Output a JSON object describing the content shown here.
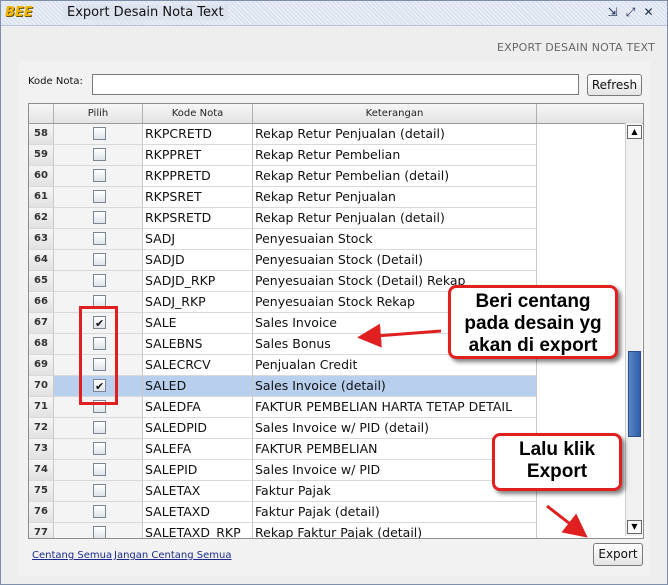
{
  "window": {
    "logo": "BEE",
    "title": "Export Desain Nota Text",
    "heading": "EXPORT DESAIN NOTA TEXT"
  },
  "filter": {
    "kode_label": "Kode Nota:",
    "kode_value": "",
    "refresh_label": "Refresh"
  },
  "table": {
    "columns": [
      "Pilih",
      "Kode Nota",
      "Keterangan"
    ],
    "rows": [
      {
        "no": "58",
        "checked": false,
        "kode": "RKPCRETD",
        "ket": "Rekap Retur Penjualan (detail)"
      },
      {
        "no": "59",
        "checked": false,
        "kode": "RKPPRET",
        "ket": "Rekap Retur Pembelian"
      },
      {
        "no": "60",
        "checked": false,
        "kode": "RKPPRETD",
        "ket": "Rekap Retur Pembelian (detail)"
      },
      {
        "no": "61",
        "checked": false,
        "kode": "RKPSRET",
        "ket": "Rekap Retur Penjualan"
      },
      {
        "no": "62",
        "checked": false,
        "kode": "RKPSRETD",
        "ket": "Rekap Retur Penjualan (detail)"
      },
      {
        "no": "63",
        "checked": false,
        "kode": "SADJ",
        "ket": "Penyesuaian Stock"
      },
      {
        "no": "64",
        "checked": false,
        "kode": "SADJD",
        "ket": "Penyesuaian Stock (Detail)"
      },
      {
        "no": "65",
        "checked": false,
        "kode": "SADJD_RKP",
        "ket": "Penyesuaian Stock (Detail) Rekap"
      },
      {
        "no": "66",
        "checked": false,
        "kode": "SADJ_RKP",
        "ket": "Penyesuaian Stock Rekap"
      },
      {
        "no": "67",
        "checked": true,
        "kode": "SALE",
        "ket": "Sales Invoice"
      },
      {
        "no": "68",
        "checked": false,
        "kode": "SALEBNS",
        "ket": "Sales Bonus"
      },
      {
        "no": "69",
        "checked": false,
        "kode": "SALECRCV",
        "ket": "Penjualan Credit"
      },
      {
        "no": "70",
        "checked": true,
        "kode": "SALED",
        "ket": "Sales Invoice (detail)",
        "selected": true
      },
      {
        "no": "71",
        "checked": false,
        "kode": "SALEDFA",
        "ket": "FAKTUR PEMBELIAN HARTA TETAP DETAIL"
      },
      {
        "no": "72",
        "checked": false,
        "kode": "SALEDPID",
        "ket": "Sales Invoice w/ PID (detail)"
      },
      {
        "no": "73",
        "checked": false,
        "kode": "SALEFA",
        "ket": "FAKTUR PEMBELIAN"
      },
      {
        "no": "74",
        "checked": false,
        "kode": "SALEPID",
        "ket": "Sales Invoice w/ PID"
      },
      {
        "no": "75",
        "checked": false,
        "kode": "SALETAX",
        "ket": "Faktur Pajak"
      },
      {
        "no": "76",
        "checked": false,
        "kode": "SALETAXD",
        "ket": "Faktur Pajak (detail)"
      },
      {
        "no": "77",
        "checked": false,
        "kode": "SALETAXD_RKP",
        "ket": "Rekap Faktur Pajak (detail)"
      }
    ]
  },
  "footer": {
    "select_all": "Centang Semua",
    "deselect_all": "Jangan Centang Semua",
    "export_label": "Export"
  },
  "annotations": {
    "callout_check": "Beri centang pada desain yg akan di export",
    "callout_export": "Lalu klik Export",
    "accent_color": "#e02020"
  }
}
